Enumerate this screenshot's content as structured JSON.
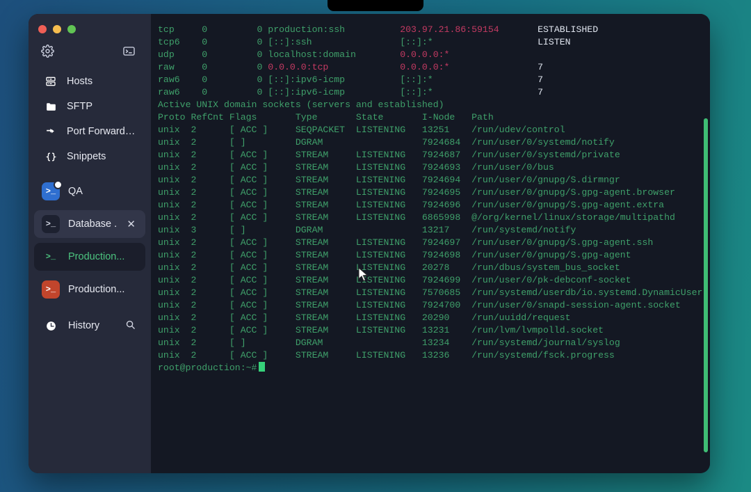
{
  "window": {
    "traffic_lights": [
      "close",
      "minimize",
      "maximize"
    ]
  },
  "sidebar": {
    "top_icons": [
      {
        "name": "gear-icon",
        "label": "Settings"
      },
      {
        "name": "terminal-icon",
        "label": "New Terminal"
      }
    ],
    "nav_items": [
      {
        "icon": "server-icon",
        "label": "Hosts"
      },
      {
        "icon": "folder-icon",
        "label": "SFTP"
      },
      {
        "icon": "arrows-icon",
        "label": "Port Forwarding"
      },
      {
        "icon": "braces-icon",
        "label": "Snippets"
      }
    ],
    "sessions": [
      {
        "label": "QA",
        "icon_color": "#2f6fd0",
        "state": "normal",
        "badge": true,
        "closable": false,
        "text_color": "#e7e9f1"
      },
      {
        "label": "Database ...",
        "icon_color": "#1d2130",
        "state": "selected",
        "badge": false,
        "closable": true,
        "text_color": "#e7e9f1"
      },
      {
        "label": "Production...",
        "icon_color": "#1b1e2b",
        "state": "active",
        "badge": false,
        "closable": false,
        "text_color": "#4cc47f"
      },
      {
        "label": "Production...",
        "icon_color": "#c1452c",
        "state": "normal",
        "badge": false,
        "closable": false,
        "text_color": "#e7e9f1"
      }
    ],
    "history": {
      "icon": "clock-icon",
      "label": "History",
      "search_icon": "search-icon"
    }
  },
  "terminal": {
    "prompt": "root@production:~#",
    "cursor": "block",
    "net_rows": [
      {
        "proto": "tcp",
        "recvq": "0",
        "sendq": "0",
        "local": "production:ssh",
        "local_color": "g",
        "foreign": "203.97.21.86:59154",
        "foreign_color": "p",
        "state": "ESTABLISHED"
      },
      {
        "proto": "tcp6",
        "recvq": "0",
        "sendq": "0",
        "local": "[::]:ssh",
        "local_color": "g",
        "foreign": "[::]:*",
        "foreign_color": "g",
        "state": "LISTEN"
      },
      {
        "proto": "udp",
        "recvq": "0",
        "sendq": "0",
        "local": "localhost:domain",
        "local_color": "g",
        "foreign": "0.0.0.0:*",
        "foreign_color": "p",
        "state": ""
      },
      {
        "proto": "raw",
        "recvq": "0",
        "sendq": "0",
        "local": "0.0.0.0:tcp",
        "local_color": "p",
        "foreign": "0.0.0.0:*",
        "foreign_color": "p",
        "state": "7"
      },
      {
        "proto": "raw6",
        "recvq": "0",
        "sendq": "0",
        "local": "[::]:ipv6-icmp",
        "local_color": "g",
        "foreign": "[::]:*",
        "foreign_color": "g",
        "state": "7"
      },
      {
        "proto": "raw6",
        "recvq": "0",
        "sendq": "0",
        "local": "[::]:ipv6-icmp",
        "local_color": "g",
        "foreign": "[::]:*",
        "foreign_color": "g",
        "state": "7"
      }
    ],
    "unix_banner": "Active UNIX domain sockets (servers and established)",
    "unix_header": {
      "proto": "Proto",
      "refcnt": "RefCnt",
      "flags": "Flags",
      "type": "Type",
      "state": "State",
      "inode": "I-Node",
      "path": "Path"
    },
    "unix_rows": [
      {
        "proto": "unix",
        "refcnt": "2",
        "flags": "[ ACC ]",
        "type": "SEQPACKET",
        "state": "LISTENING",
        "inode": "13251",
        "path": "/run/udev/control"
      },
      {
        "proto": "unix",
        "refcnt": "2",
        "flags": "[ ]",
        "type": "DGRAM",
        "state": "",
        "inode": "7924684",
        "path": "/run/user/0/systemd/notify"
      },
      {
        "proto": "unix",
        "refcnt": "2",
        "flags": "[ ACC ]",
        "type": "STREAM",
        "state": "LISTENING",
        "inode": "7924687",
        "path": "/run/user/0/systemd/private"
      },
      {
        "proto": "unix",
        "refcnt": "2",
        "flags": "[ ACC ]",
        "type": "STREAM",
        "state": "LISTENING",
        "inode": "7924693",
        "path": "/run/user/0/bus"
      },
      {
        "proto": "unix",
        "refcnt": "2",
        "flags": "[ ACC ]",
        "type": "STREAM",
        "state": "LISTENING",
        "inode": "7924694",
        "path": "/run/user/0/gnupg/S.dirmngr"
      },
      {
        "proto": "unix",
        "refcnt": "2",
        "flags": "[ ACC ]",
        "type": "STREAM",
        "state": "LISTENING",
        "inode": "7924695",
        "path": "/run/user/0/gnupg/S.gpg-agent.browser"
      },
      {
        "proto": "unix",
        "refcnt": "2",
        "flags": "[ ACC ]",
        "type": "STREAM",
        "state": "LISTENING",
        "inode": "7924696",
        "path": "/run/user/0/gnupg/S.gpg-agent.extra"
      },
      {
        "proto": "unix",
        "refcnt": "2",
        "flags": "[ ACC ]",
        "type": "STREAM",
        "state": "LISTENING",
        "inode": "6865998",
        "path": "@/org/kernel/linux/storage/multipathd"
      },
      {
        "proto": "unix",
        "refcnt": "3",
        "flags": "[ ]",
        "type": "DGRAM",
        "state": "",
        "inode": "13217",
        "path": "/run/systemd/notify"
      },
      {
        "proto": "unix",
        "refcnt": "2",
        "flags": "[ ACC ]",
        "type": "STREAM",
        "state": "LISTENING",
        "inode": "7924697",
        "path": "/run/user/0/gnupg/S.gpg-agent.ssh"
      },
      {
        "proto": "unix",
        "refcnt": "2",
        "flags": "[ ACC ]",
        "type": "STREAM",
        "state": "LISTENING",
        "inode": "7924698",
        "path": "/run/user/0/gnupg/S.gpg-agent"
      },
      {
        "proto": "unix",
        "refcnt": "2",
        "flags": "[ ACC ]",
        "type": "STREAM",
        "state": "LISTENING",
        "inode": "20278",
        "path": "/run/dbus/system_bus_socket"
      },
      {
        "proto": "unix",
        "refcnt": "2",
        "flags": "[ ACC ]",
        "type": "STREAM",
        "state": "LISTENING",
        "inode": "7924699",
        "path": "/run/user/0/pk-debconf-socket"
      },
      {
        "proto": "unix",
        "refcnt": "2",
        "flags": "[ ACC ]",
        "type": "STREAM",
        "state": "LISTENING",
        "inode": "7570685",
        "path": "/run/systemd/userdb/io.systemd.DynamicUser"
      },
      {
        "proto": "unix",
        "refcnt": "2",
        "flags": "[ ACC ]",
        "type": "STREAM",
        "state": "LISTENING",
        "inode": "7924700",
        "path": "/run/user/0/snapd-session-agent.socket"
      },
      {
        "proto": "unix",
        "refcnt": "2",
        "flags": "[ ACC ]",
        "type": "STREAM",
        "state": "LISTENING",
        "inode": "20290",
        "path": "/run/uuidd/request"
      },
      {
        "proto": "unix",
        "refcnt": "2",
        "flags": "[ ACC ]",
        "type": "STREAM",
        "state": "LISTENING",
        "inode": "13231",
        "path": "/run/lvm/lvmpolld.socket"
      },
      {
        "proto": "unix",
        "refcnt": "2",
        "flags": "[ ]",
        "type": "DGRAM",
        "state": "",
        "inode": "13234",
        "path": "/run/systemd/journal/syslog"
      },
      {
        "proto": "unix",
        "refcnt": "2",
        "flags": "[ ACC ]",
        "type": "STREAM",
        "state": "LISTENING",
        "inode": "13236",
        "path": "/run/systemd/fsck.progress"
      }
    ]
  },
  "colors": {
    "terminal_bg": "#141823",
    "sidebar_bg": "#262a3a",
    "green": "#3fa06a",
    "magenta": "#c43a62",
    "white": "#dfe4ee",
    "scrollbar": "#3fbd74",
    "cursor": "#36d17a"
  }
}
